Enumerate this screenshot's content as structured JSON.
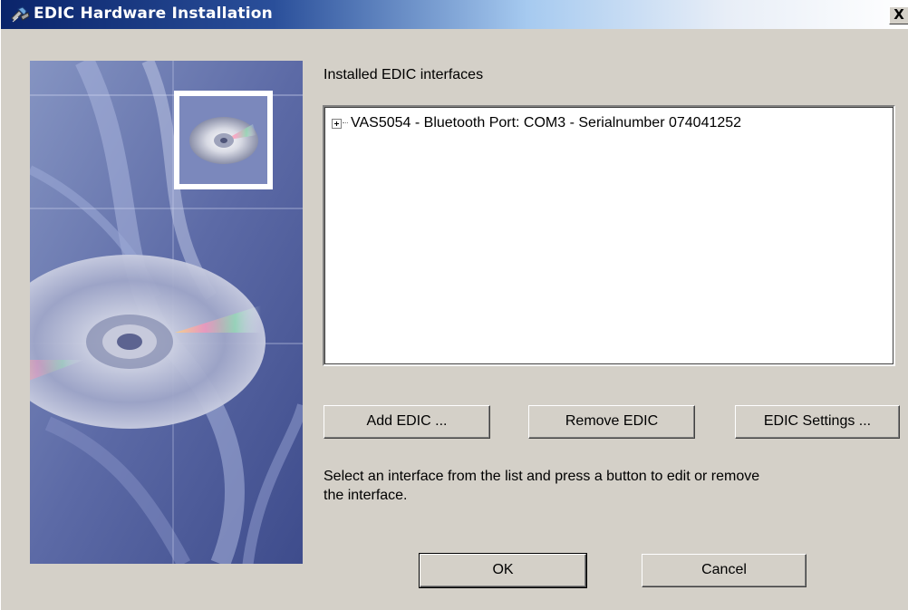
{
  "window": {
    "title": "EDIC Hardware Installation",
    "close_glyph": "X"
  },
  "side_image": {
    "icon": "cd-disc-image"
  },
  "installed": {
    "label": "Installed EDIC interfaces",
    "items": [
      {
        "label": "VAS5054 - Bluetooth Port: COM3 - Serialnumber 074041252",
        "expanded": false
      }
    ]
  },
  "buttons": {
    "add": "Add EDIC ...",
    "remove": "Remove EDIC",
    "settings": "EDIC Settings ...",
    "ok": "OK",
    "cancel": "Cancel"
  },
  "hint": {
    "line1": "Select an interface from the list and press a button to edit or remove",
    "line2": "the interface."
  },
  "colors": {
    "title_gradient_start": "#0a246a",
    "dialog_background": "#d4d0c8"
  }
}
